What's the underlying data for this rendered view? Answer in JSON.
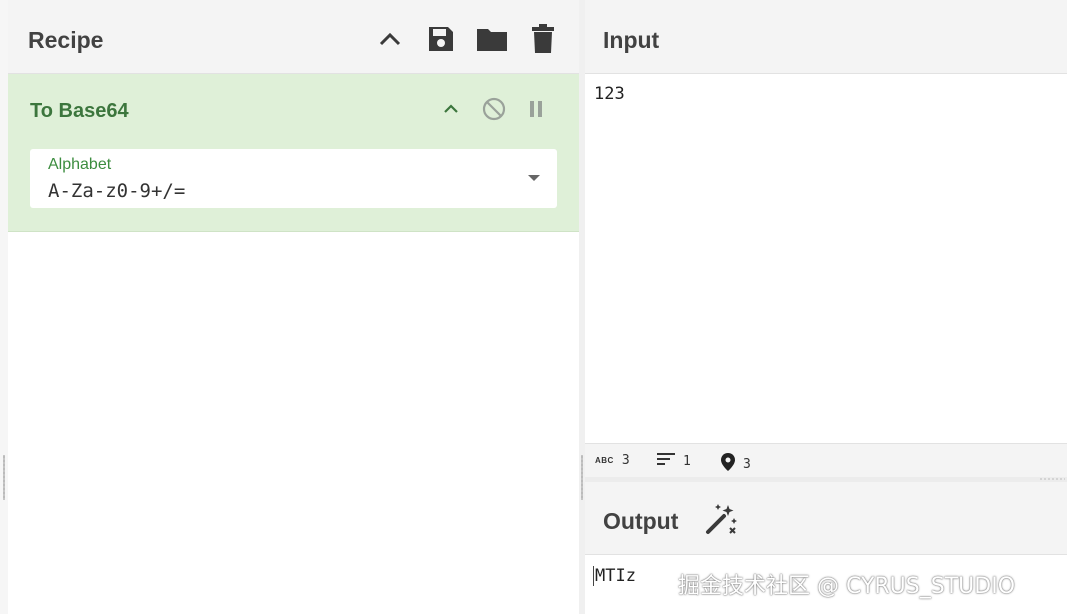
{
  "recipe": {
    "title": "Recipe",
    "header_icons": [
      "chevron-up-icon",
      "save-icon",
      "folder-icon",
      "trash-icon"
    ],
    "operation": {
      "name": "To Base64",
      "icons": [
        "chevron-up-icon",
        "disable-icon",
        "pause-icon"
      ],
      "argument": {
        "label": "Alphabet",
        "value": "A-Za-z0-9+/="
      }
    }
  },
  "input": {
    "title": "Input",
    "text": "123",
    "status": {
      "length": "3",
      "lines": "1",
      "position": "3"
    }
  },
  "output": {
    "title": "Output",
    "text": "MTIz"
  },
  "watermark": "掘金技术社区 @ CYRUS_STUDIO",
  "colors": {
    "operation_bg": "#dff0d8",
    "operation_title": "#3c763d",
    "header_bg": "#f4f4f4"
  }
}
